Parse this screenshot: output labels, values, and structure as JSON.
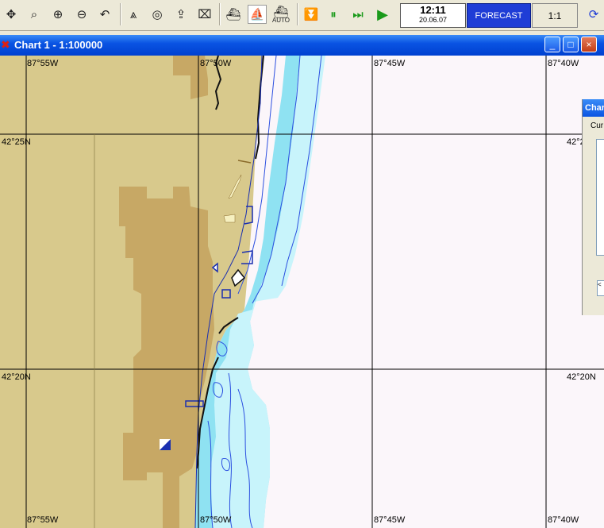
{
  "toolbar": {
    "icons": [
      "move-icon",
      "zoom-box-icon",
      "zoom-in-icon",
      "zoom-out-icon",
      "undo-icon",
      "route-icon",
      "target-icon",
      "upload-icon",
      "delete-icon",
      "ship-icon",
      "ship-track-icon",
      "ship-auto-icon",
      "download-icon",
      "pause-icon",
      "fast-forward-icon",
      "play-icon"
    ],
    "auto_label": "AUTO",
    "time": "12:11",
    "date": "20.06.07",
    "forecast_label": "FORECAST",
    "scale_label": "1:1"
  },
  "window": {
    "title": "Chart 1 - 1:100000",
    "minimize": "_",
    "maximize": "□",
    "close": "×"
  },
  "map": {
    "lon_labels": [
      "87°55W",
      "87°50W",
      "87°45W",
      "87°40W"
    ],
    "lat_labels": [
      "42°25N",
      "42°20N"
    ],
    "colors": {
      "land": "#d8c98c",
      "urban": "#c7a865",
      "shallow": "#8fe2f2",
      "medium": "#c8f4fb",
      "deep": "#fbf6fa",
      "grid": "#000000",
      "isobath": "#2b4fe0",
      "coast": "#111111"
    }
  },
  "panel": {
    "title": "Char",
    "label": "Cur",
    "box": "<"
  }
}
